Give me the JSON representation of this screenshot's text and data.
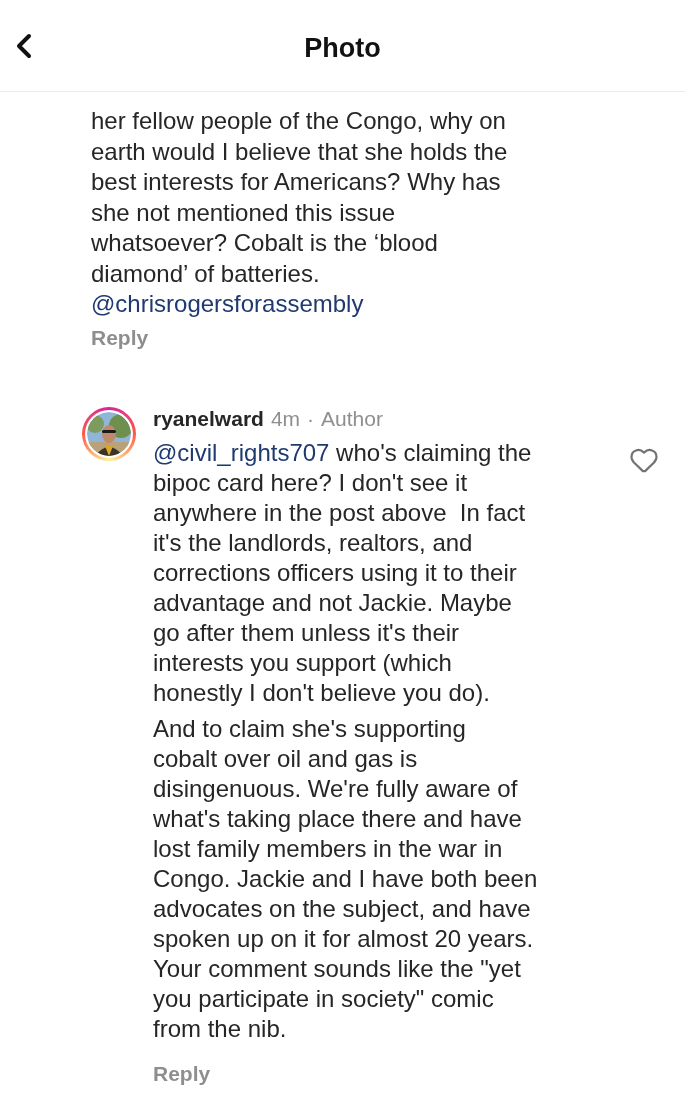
{
  "header": {
    "title": "Photo"
  },
  "comments": [
    {
      "kind": "continuation",
      "lines": [
        "her fellow people of the Congo, why on",
        "earth would I believe that she holds the",
        "best interests for Americans? Why has",
        "she not mentioned this issue",
        "whatsoever? Cobalt is the ‘blood",
        "diamond’ of batteries."
      ],
      "mention": "@chrisrogersforassembly",
      "reply": "Reply"
    },
    {
      "kind": "full",
      "username": "ryanelward",
      "time": "4m",
      "separator": "·",
      "badge": "Author",
      "liked": false,
      "mention": "@civil_rights707",
      "paragraphs": [
        [
          "who's claiming the",
          "bipoc card here? I don't see it",
          "anywhere in the post above  In fact",
          "it's the landlords, realtors, and",
          "corrections officers using it to their",
          "advantage and not Jackie. Maybe",
          "go after them unless it's their",
          "interests you support (which",
          "honestly I don't believe you do)."
        ],
        [
          "And to claim she's supporting",
          "cobalt over oil and gas is",
          "disingenuous. We're fully aware of",
          "what's taking place there and have",
          "lost family members in the war in",
          "Congo. Jackie and I have both been",
          "advocates on the subject, and have",
          "spoken up on it for almost 20 years.",
          "Your comment sounds like the \"yet",
          "you participate in society\" comic",
          "from the nib."
        ]
      ],
      "reply": "Reply"
    }
  ]
}
